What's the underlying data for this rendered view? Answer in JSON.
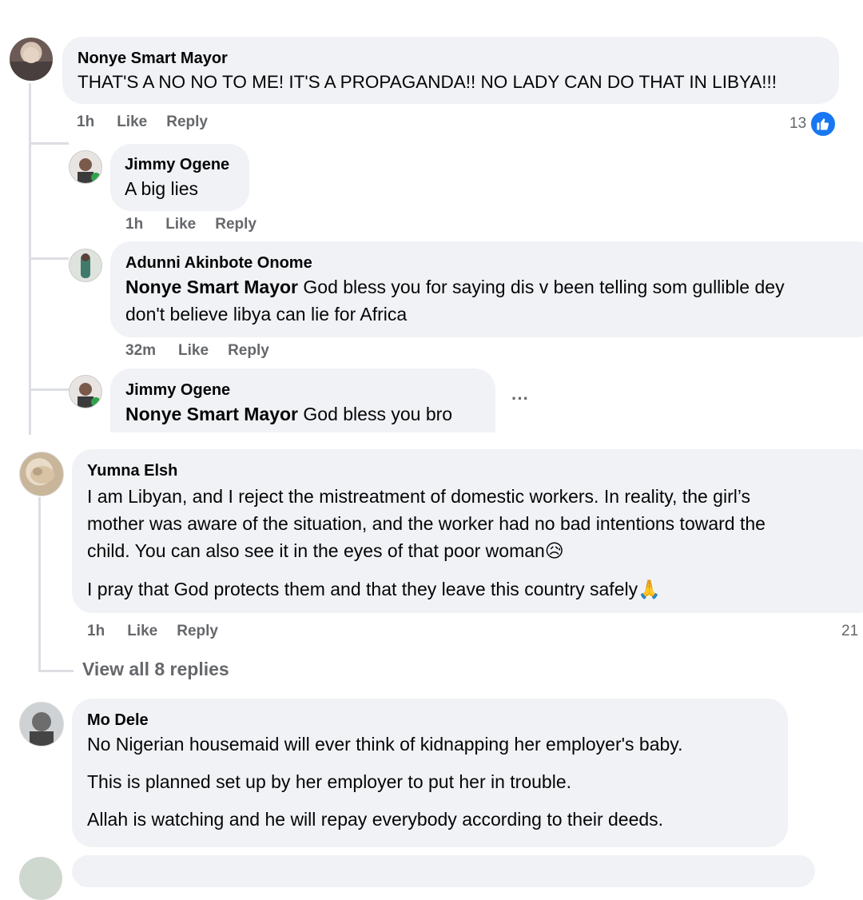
{
  "comments": [
    {
      "author": "Nonye Smart Mayor",
      "text": "THAT'S A NO NO TO ME! IT'S A PROPAGANDA!! NO LADY CAN DO THAT IN LIBYA!!!",
      "time": "1h",
      "like": "Like",
      "reply": "Reply",
      "reactions": "13",
      "replies": [
        {
          "author": "Jimmy Ogene",
          "text": "A big lies",
          "time": "1h",
          "like": "Like",
          "reply": "Reply"
        },
        {
          "author": "Adunni Akinbote Onome",
          "mention": "Nonye Smart Mayor",
          "text_line1": " God bless you for saying dis v been telling som gullible dey",
          "text_line2": "don't believe libya can lie for Africa",
          "time": "32m",
          "like": "Like",
          "reply": "Reply"
        },
        {
          "author": "Jimmy Ogene",
          "mention": "Nonye Smart Mayor",
          "text": " God bless you bro",
          "more": "···"
        }
      ]
    },
    {
      "author": "Yumna Elsh",
      "lines": [
        "I am Libyan, and I reject the mistreatment of domestic workers. In reality, the girl’s",
        "mother was aware of the situation, and the worker had no bad intentions toward the",
        "child. You can also see it in the eyes of that poor woman😥",
        "I pray that God protects them and that they leave this country safely🙏"
      ],
      "time": "1h",
      "like": "Like",
      "reply": "Reply",
      "reactions": "21",
      "view_replies": "View all 8 replies"
    },
    {
      "author": "Mo Dele",
      "lines": [
        "No Nigerian housemaid will ever think of kidnapping her employer's baby.",
        "This is planned set up by her employer to put her in trouble.",
        "Allah is watching and he will repay everybody according to their deeds."
      ]
    }
  ],
  "colors": {
    "bubble": "#f0f2f5",
    "meta": "#65676b",
    "like_blue": "#1877f2"
  }
}
